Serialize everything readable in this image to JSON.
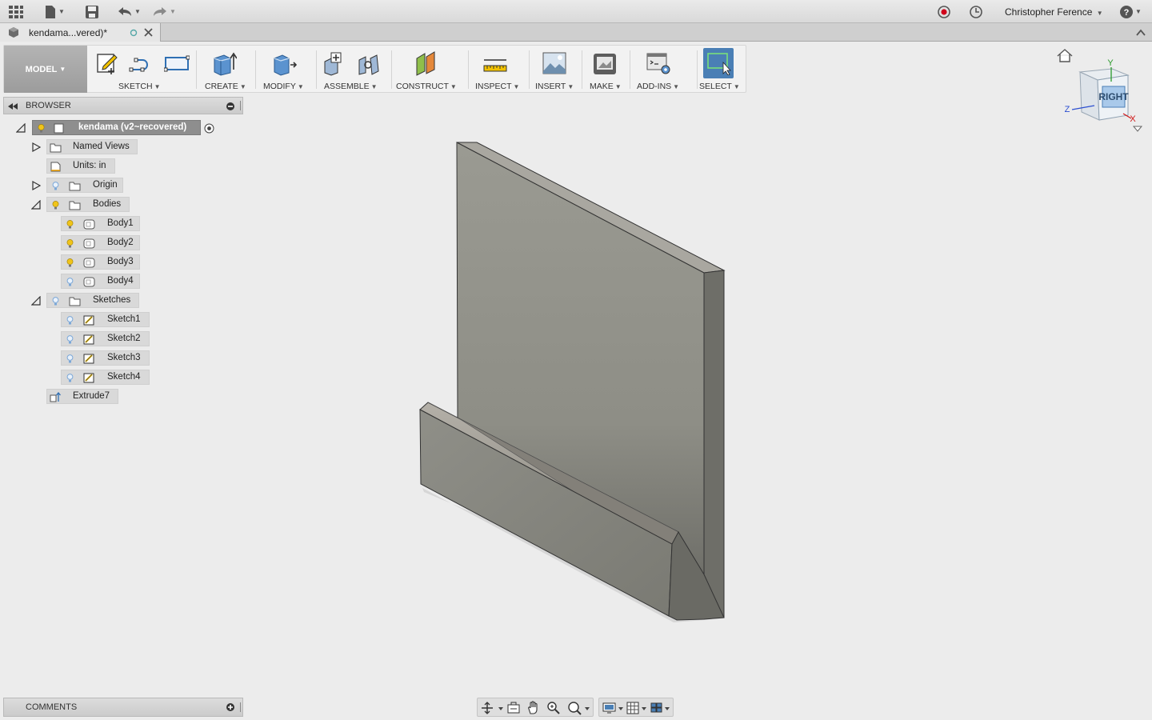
{
  "app": {
    "document_tab": "kendama...vered)*",
    "user": "Christopher Ference"
  },
  "toolbar": {
    "workspace": "MODEL",
    "groups": [
      {
        "label": "SKETCH"
      },
      {
        "label": "CREATE"
      },
      {
        "label": "MODIFY"
      },
      {
        "label": "ASSEMBLE"
      },
      {
        "label": "CONSTRUCT"
      },
      {
        "label": "INSPECT"
      },
      {
        "label": "INSERT"
      },
      {
        "label": "MAKE"
      },
      {
        "label": "ADD-INS"
      },
      {
        "label": "SELECT"
      }
    ]
  },
  "browser": {
    "title": "BROWSER",
    "root": "kendama (v2~recovered)",
    "nodes": {
      "named_views": "Named Views",
      "units": "Units: in",
      "origin": "Origin",
      "bodies": "Bodies",
      "body1": "Body1",
      "body2": "Body2",
      "body3": "Body3",
      "body4": "Body4",
      "sketches": "Sketches",
      "sketch1": "Sketch1",
      "sketch2": "Sketch2",
      "sketch3": "Sketch3",
      "sketch4": "Sketch4",
      "extrude": "Extrude7"
    }
  },
  "comments": {
    "title": "COMMENTS"
  },
  "viewcube": {
    "face": "RIGHT",
    "axis_y": "Y",
    "axis_z": "Z",
    "axis_x": "X"
  },
  "colors": {
    "accent_select": "#4a7fb5",
    "bulb_on": "#f0c419",
    "bulb_off": "#7aa7d8"
  }
}
